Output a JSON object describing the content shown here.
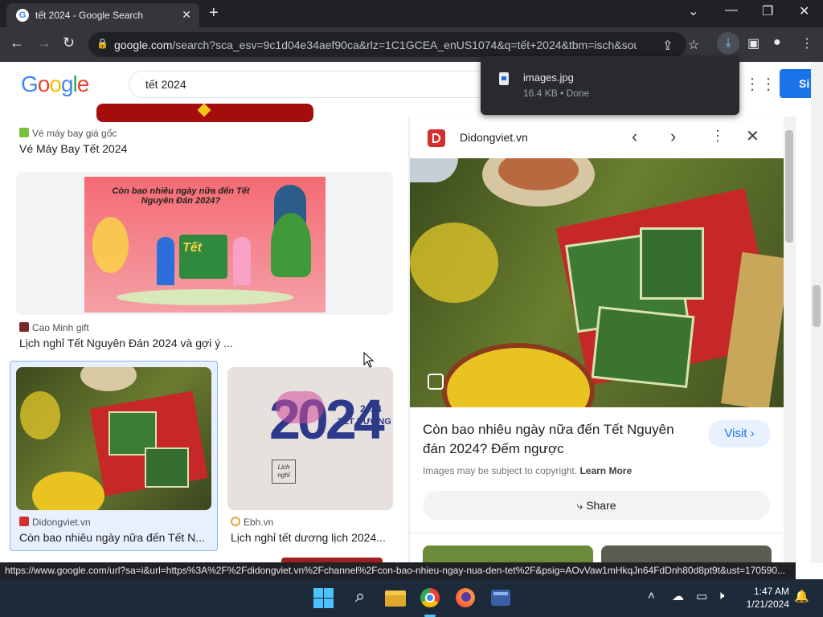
{
  "browser": {
    "tab_title": "tết 2024 - Google Search",
    "tab_close": "✕",
    "new_tab": "+",
    "url_domain": "google.com",
    "url_rest": "/search?sca_esv=9c1d04e34aef90ca&rlz=1C1GCEA_enUS1074&q=tết+2024&tbm=isch&sourc...",
    "window_controls": [
      "⌄",
      "—",
      "❐",
      "✕"
    ]
  },
  "download_popup": {
    "filename": "images.jpg",
    "meta": "16.4 KB • Done"
  },
  "google": {
    "logo": "Google",
    "search_query": "tết 2024",
    "signin_label": "Si"
  },
  "results": [
    {
      "source": "Vé máy bay giá gốc",
      "title": "Vé Máy Bay Tết 2024"
    },
    {
      "source": "Cao Minh gift",
      "title": "Lịch nghỉ Tết Nguyên Đán 2024 và gợi ý ...",
      "image_text": "Còn bao nhiêu ngày nữa đến Tết Nguyên Đán 2024?",
      "image_badge": "Tết"
    },
    {
      "source": "Didongviet.vn",
      "title": "Còn bao nhiêu ngày nữa đến Tết N..."
    },
    {
      "source": "Ebh.vn",
      "title": "Lịch nghỉ tết dương lịch 2024...",
      "image_big": "2024",
      "image_small_1": "2024",
      "image_small_2": "TẾT DƯƠNG",
      "image_stamp": "Lịch nghỉ"
    }
  ],
  "panel": {
    "site": "Didongviet.vn",
    "title": "Còn bao nhiêu ngày nữa đến Tết Nguyên đán 2024? Đếm ngược",
    "visit_label": "Visit",
    "copyright_text": "Images may be subject to copyright.",
    "learn_more": "Learn More",
    "share_label": "Share"
  },
  "status_url": "https://www.google.com/url?sa=i&url=https%3A%2F%2Fdidongviet.vn%2Fchannel%2Fcon-bao-nhieu-ngay-nua-den-tet%2F&psig=AOvVaw1mHkqJn64FdDnh80d8pt9t&ust=170590...",
  "taskbar": {
    "time": "1:47 AM",
    "date": "1/21/2024"
  },
  "colors": {
    "chrome_dark": "#202124",
    "chrome_toolbar": "#35363a",
    "google_blue": "#4285f4",
    "google_red": "#ea4335",
    "google_yellow": "#fbbc05",
    "google_green": "#34a853",
    "link_blue": "#1a73e8"
  }
}
